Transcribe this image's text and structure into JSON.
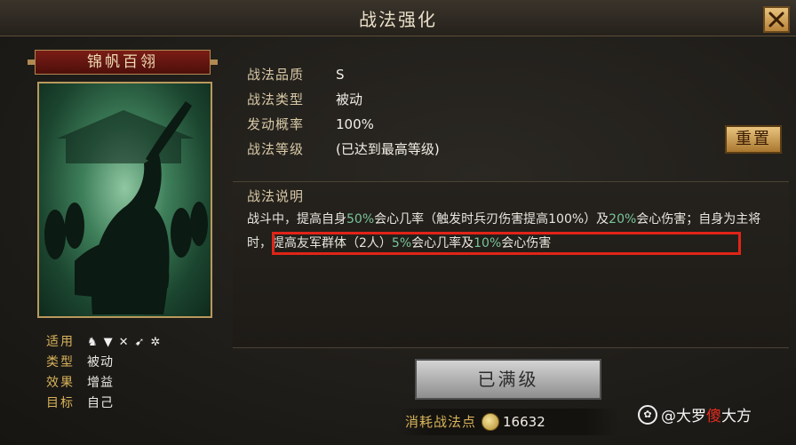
{
  "header": {
    "title": "战法强化"
  },
  "skill": {
    "name": "锦帆百翎",
    "info": [
      {
        "key": "战法品质",
        "value": "S"
      },
      {
        "key": "战法类型",
        "value": "被动"
      },
      {
        "key": "发动概率",
        "value": "100%"
      },
      {
        "key": "战法等级",
        "value": "(已达到最高等级)"
      }
    ],
    "reset_label": "重置",
    "description_title": "战法说明",
    "description": {
      "p1": "战斗中，提高自身",
      "v1": "50%",
      "p2": "会心几率（触发时兵刃伤害提高100%）及",
      "v2": "20%",
      "p3": "会心伤害；",
      "h1": "自身为主将时，提高友军群体（2人）",
      "v3": "5%",
      "h2": "会心几率及",
      "v4": "10%",
      "h3": "会心伤害"
    }
  },
  "stats": {
    "applicable_label": "适用",
    "applicable_icons": [
      "cavalry-icon",
      "shield-icon",
      "crossed-swords-icon",
      "spear-icon",
      "wheel-icon"
    ],
    "type_label": "类型",
    "type_value": "被动",
    "effect_label": "效果",
    "effect_value": "增益",
    "target_label": "目标",
    "target_value": "自己"
  },
  "actions": {
    "max_level_label": "已满级"
  },
  "cost": {
    "label": "消耗战法点",
    "value": "16632"
  },
  "watermark": {
    "prefix": "@大罗",
    "red": "傻",
    "suffix": "大方"
  },
  "colors": {
    "accent_gold": "#d8b35a",
    "highlight_green": "#79c49a",
    "annotation_red": "#e02418"
  }
}
